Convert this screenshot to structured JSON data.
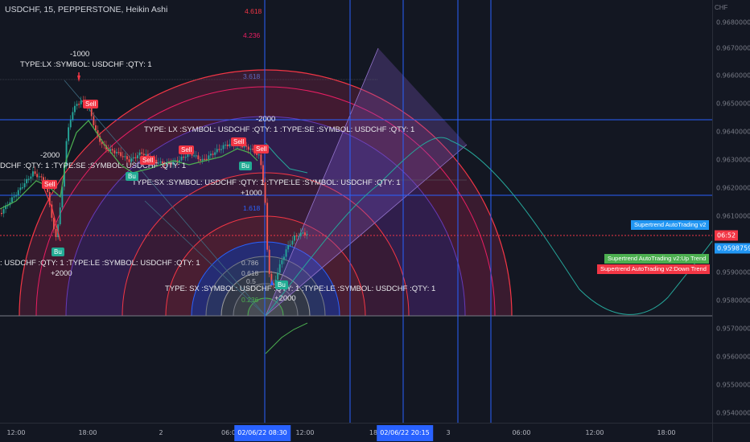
{
  "header": {
    "title": "USDCHF, 15, PEPPERSTONE, Heikin Ashi",
    "currency": "CHF"
  },
  "price_axis": {
    "ticks": [
      "0.9680000",
      "0.9670000",
      "0.9660000",
      "0.9650000",
      "0.9640000",
      "0.9630000",
      "0.9620000",
      "0.9610000",
      "0.9590000",
      "0.9580000",
      "0.9570000",
      "0.9560000",
      "0.9550000",
      "0.9540000"
    ],
    "countdown": "06:52",
    "current_price": "0.9598759"
  },
  "time_axis": {
    "ticks": [
      "12:00",
      "18:00",
      "2",
      "06:0",
      "12:00",
      "18",
      "3",
      "06:00",
      "12:00",
      "18:00"
    ],
    "badge_1": "02/06/22  08:30",
    "badge_2": "02/06/22  20:15"
  },
  "legends": {
    "supertrend": "Supertrend AutoTrading v2",
    "up_trend": "Supertrend AutoTrading v2:Up Trend",
    "down_trend": "Supertrend AutoTrading v2:Down Trend"
  },
  "fib_levels": [
    "4.618",
    "4.236",
    "3.618",
    "1.618",
    "0.786",
    "0.618",
    "0.5",
    "0.236"
  ],
  "annotations": {
    "a1": "-1000",
    "a2": "TYPE:LX  :SYMBOL: USDCHF :QTY: 1",
    "a3": "-2000",
    "a4": "TYPE: LX :SYMBOL: USDCHF :QTY: 1 :TYPE:SE  :SYMBOL: USDCHF :QTY: 1",
    "a5": "-2000",
    "a6": "DCHF :QTY: 1 :TYPE:SE  :SYMBOL: USDCHF :QTY: 1",
    "a7": "TYPE:SX :SYMBOL: USDCHF :QTY: 1 :TYPE:LE  :SYMBOL: USDCHF :QTY: 1",
    "a8": "+1000",
    "a9": ": USDCHF :QTY: 1 :TYPE:LE  :SYMBOL: USDCHF :QTY: 1",
    "a10": "+2000",
    "a11": "TYPE: SX :SYMBOL: USDCHF :QTY: 1 :TYPE:LE  :SYMBOL: USDCHF :QTY: 1",
    "a12": "+2000"
  },
  "signals": {
    "sell": "Sell",
    "buy": "Bu",
    "buy_full": "Buy"
  },
  "colors": {
    "background": "#131722",
    "up": "#26a69a",
    "down": "#ef5350",
    "accent": "#2962ff",
    "supertrend_up": "#4caf50",
    "supertrend_down": "#f23645"
  }
}
